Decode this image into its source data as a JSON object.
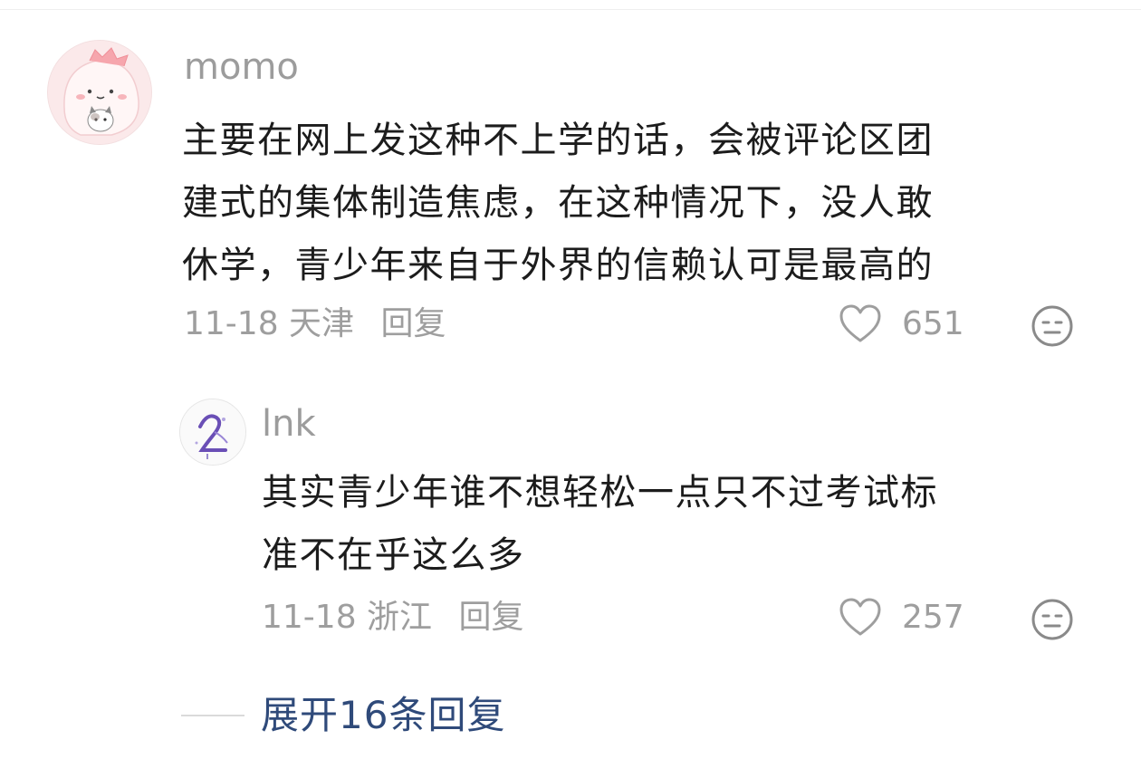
{
  "main_comment": {
    "username": "momo",
    "text_lines": [
      "主要在网上发这种不上学的话，会被评论区团",
      "建式的集体制造焦虑，在这种情况下，没人敢",
      "休学，青少年来自于外界的信赖认可是最高的"
    ],
    "date_location": "11-18 天津",
    "reply_label": "回复",
    "likes": "651"
  },
  "reply_comment": {
    "username": "lnk",
    "text_lines": [
      "其实青少年谁不想轻松一点只不过考试标",
      "准不在乎这么多"
    ],
    "date_location": "11-18 浙江",
    "reply_label": "回复",
    "likes": "257"
  },
  "expand_replies": {
    "label": "展开16条回复"
  },
  "icons": {
    "like": "heart-outline-icon",
    "emotion": "neutral-face-icon"
  },
  "colors": {
    "text": "#1c1c1c",
    "meta": "#9e9e9e",
    "link": "#2f4a7a",
    "avatar_bg": "#fbe9ea"
  }
}
